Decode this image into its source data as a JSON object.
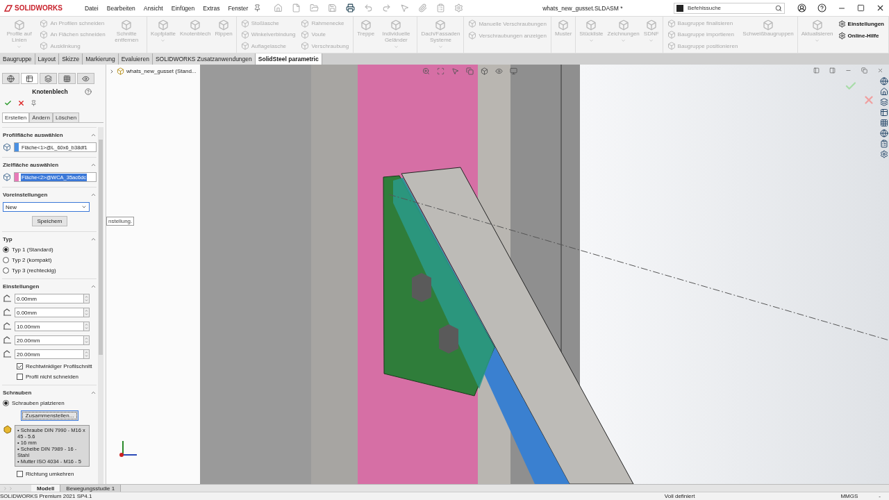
{
  "title_bar": {
    "logo": "SOLIDWORKS",
    "menus": [
      "Datei",
      "Bearbeiten",
      "Ansicht",
      "Einfügen",
      "Extras",
      "Fenster"
    ],
    "document_title": "whats_new_gusset.SLDASM *",
    "search": {
      "placeholder": "Befehlssuche"
    }
  },
  "ribbon": {
    "groups": [
      {
        "items": [
          {
            "label": "Profile auf Linien",
            "kind": "large",
            "disabled": true,
            "dropdown": true
          },
          {
            "label": "An Profilen schneiden",
            "kind": "small",
            "disabled": true
          },
          {
            "label": "An Flächen schneiden",
            "kind": "small",
            "disabled": true
          },
          {
            "label": "Ausklinkung",
            "kind": "small",
            "disabled": true
          },
          {
            "label": "Schnitte entfernen",
            "kind": "large",
            "disabled": true,
            "dropdown": false
          }
        ]
      },
      {
        "items": [
          {
            "label": "Kopfplatte",
            "kind": "large",
            "disabled": true,
            "dropdown": true
          },
          {
            "label": "Knotenblech",
            "kind": "large",
            "disabled": true,
            "dropdown": false
          },
          {
            "label": "Rippen",
            "kind": "large",
            "disabled": true,
            "dropdown": false
          }
        ]
      },
      {
        "items": [
          {
            "label": "Stoßlasche",
            "kind": "small",
            "disabled": true
          },
          {
            "label": "Winkelverbindung",
            "kind": "small",
            "disabled": true
          },
          {
            "label": "Auflagelasche",
            "kind": "small",
            "disabled": true
          },
          {
            "label": "Rahmenecke",
            "kind": "small",
            "disabled": true
          },
          {
            "label": "Voute",
            "kind": "small",
            "disabled": true
          },
          {
            "label": "Verschraubung",
            "kind": "small",
            "disabled": true
          }
        ]
      },
      {
        "items": [
          {
            "label": "Treppe",
            "kind": "large",
            "disabled": true,
            "dropdown": false
          },
          {
            "label": "Individuelle Geländer",
            "kind": "large",
            "disabled": true,
            "dropdown": true
          }
        ]
      },
      {
        "items": [
          {
            "label": "Dach/Fassaden Systeme",
            "kind": "large",
            "disabled": true,
            "dropdown": true
          }
        ]
      },
      {
        "items": [
          {
            "label": "Manuelle Verschraubungen",
            "kind": "small",
            "disabled": true
          },
          {
            "label": "Verschraubungen anzeigen",
            "kind": "small",
            "disabled": true
          }
        ]
      },
      {
        "items": [
          {
            "label": "Muster",
            "kind": "large",
            "disabled": true,
            "dropdown": false
          }
        ]
      },
      {
        "items": [
          {
            "label": "Stückliste",
            "kind": "large",
            "disabled": true,
            "dropdown": true
          },
          {
            "label": "Zeichnungen",
            "kind": "large",
            "disabled": true,
            "dropdown": true
          },
          {
            "label": "SDNF",
            "kind": "large",
            "disabled": true,
            "dropdown": true
          }
        ]
      },
      {
        "items": [
          {
            "label": "Baugruppe finalisieren",
            "kind": "small",
            "disabled": true
          },
          {
            "label": "Baugruppe importieren",
            "kind": "small",
            "disabled": true
          },
          {
            "label": "Baugruppe positionieren",
            "kind": "small",
            "disabled": true
          },
          {
            "label": "Schweißbaugruppen",
            "kind": "large",
            "disabled": true,
            "dropdown": false
          }
        ]
      },
      {
        "items": [
          {
            "label": "Aktualisieren",
            "kind": "large",
            "disabled": true,
            "dropdown": true
          },
          {
            "label": "Einstellungen",
            "kind": "small",
            "disabled": false
          },
          {
            "label": "Online-Hilfe",
            "kind": "small",
            "disabled": false
          }
        ]
      }
    ]
  },
  "command_tabs": [
    {
      "label": "Baugruppe",
      "selected": false
    },
    {
      "label": "Layout",
      "selected": false
    },
    {
      "label": "Skizze",
      "selected": false
    },
    {
      "label": "Markierung",
      "selected": false
    },
    {
      "label": "Evaluieren",
      "selected": false
    },
    {
      "label": "SOLIDWORKS Zusatzanwendungen",
      "selected": false
    },
    {
      "label": "SolidSteel parametric",
      "selected": true
    }
  ],
  "property_manager": {
    "panel_tabs": [
      {
        "selected": false
      },
      {
        "selected": true
      },
      {
        "selected": false
      },
      {
        "selected": false
      },
      {
        "selected": false
      }
    ],
    "title": "Knotenblech",
    "tabs": [
      {
        "label": "Erstellen",
        "selected": true
      },
      {
        "label": "Ändern",
        "selected": false
      },
      {
        "label": "Löschen",
        "selected": false
      }
    ],
    "sections": [
      {
        "title": "Profilfläche auswählen",
        "items": [
          {
            "kind": "selection",
            "value": "Fläche<1>@L_60x6_b38df1",
            "color": "#4a90e2",
            "highlighted": false
          }
        ]
      },
      {
        "title": "Zielfläche auswählen",
        "items": [
          {
            "kind": "selection",
            "value": "Fläche<2>@WCA_35ac6dc",
            "color": "#e87ab8",
            "highlighted": true
          }
        ]
      },
      {
        "title": "Voreinstellungen",
        "items": [
          {
            "kind": "dropdown",
            "value": "New"
          },
          {
            "kind": "button",
            "label": "Speichern",
            "focused": false
          }
        ]
      },
      {
        "title": "Typ",
        "items": [
          {
            "kind": "radio",
            "label": "Typ 1 (Standard)",
            "selected": true
          },
          {
            "kind": "radio",
            "label": "Typ 2 (kompakt)",
            "selected": false
          },
          {
            "kind": "radio",
            "label": "Typ 3 (rechteckig)",
            "selected": false
          }
        ]
      },
      {
        "title": "Einstellungen",
        "items": [
          {
            "kind": "spin",
            "value": "0.00mm"
          },
          {
            "kind": "spin",
            "value": "0.00mm"
          },
          {
            "kind": "spin",
            "value": "10.00mm"
          },
          {
            "kind": "spin",
            "value": "20.00mm"
          },
          {
            "kind": "spin",
            "value": "20.00mm"
          },
          {
            "kind": "checkbox",
            "label": "Rechtwinkliger Profilschnitt",
            "checked": true
          },
          {
            "kind": "checkbox",
            "label": "Profil nicht schneiden",
            "checked": false
          }
        ]
      },
      {
        "title": "Schrauben",
        "items": [
          {
            "kind": "radio",
            "label": "Schrauben platzieren",
            "selected": true
          },
          {
            "kind": "button",
            "label": "Zusammenstellen...",
            "focused": true
          },
          {
            "kind": "listbox",
            "lines": [
              "• Schraube DIN 7990 - M16 x 45 - 5.6",
              "• 16 mm",
              "• Scheibe DIN 7989 - 16 - Stahl",
              "• Mutter ISO 4034 - M16 - 5"
            ]
          },
          {
            "kind": "checkbox",
            "label": "Richtung umkehren",
            "checked": false
          }
        ]
      }
    ]
  },
  "tree": {
    "items": [
      {
        "label": "whats_new_gusset  (Stand..."
      }
    ]
  },
  "tooltip": "nstellung.",
  "bottom_tabs": [
    {
      "label": "Modell",
      "selected": true
    },
    {
      "label": "Bewegungsstudie 1",
      "selected": false
    }
  ],
  "status_bar": {
    "product": "SOLIDWORKS Premium 2021 SP4.1",
    "state": "Voll definiert",
    "units": "MMGS",
    "field_4": "-"
  }
}
